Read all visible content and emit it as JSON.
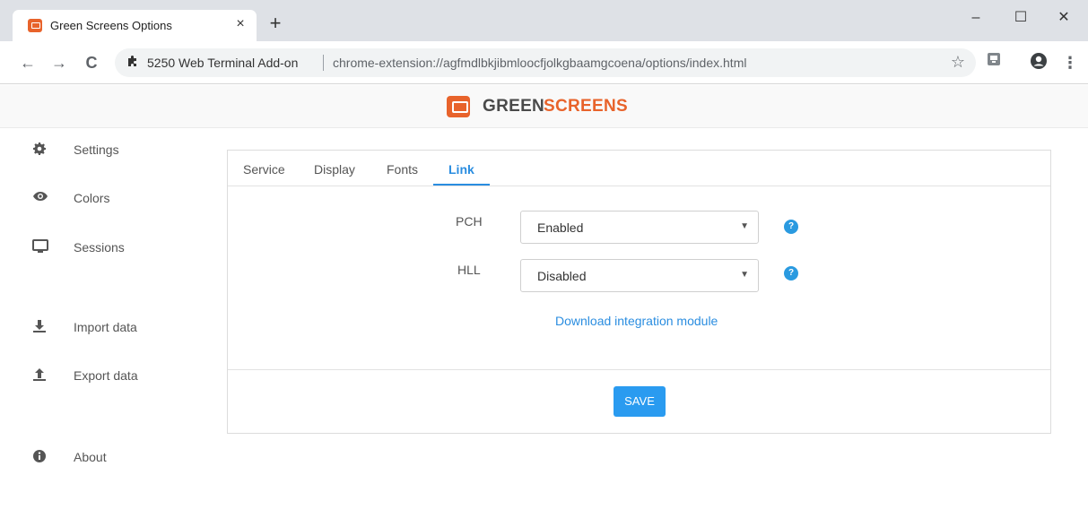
{
  "browser": {
    "tab_title": "Green Screens Options",
    "tab_close": "×",
    "new_tab": "+",
    "minimize": "–",
    "maximize": "☐",
    "close": "✕",
    "back": "←",
    "forward": "→",
    "reload": "C",
    "site_name": "5250 Web Terminal Add-on",
    "url": "chrome-extension://agfmdlbkjibmloocfjolkgbaamgcoena/options/index.html",
    "star": "☆",
    "menu": "⋮"
  },
  "header": {
    "logo_part1": "GREEN",
    "logo_part2": "SCREENS",
    "brand_color": "#e8632b"
  },
  "sidebar": {
    "items": [
      {
        "label": "Settings",
        "icon": "gear-icon"
      },
      {
        "label": "Colors",
        "icon": "eye-icon"
      },
      {
        "label": "Sessions",
        "icon": "monitor-icon"
      },
      {
        "label": "Import data",
        "icon": "download-icon"
      },
      {
        "label": "Export data",
        "icon": "upload-icon"
      },
      {
        "label": "About",
        "icon": "info-icon"
      }
    ]
  },
  "tabs": [
    {
      "label": "Service"
    },
    {
      "label": "Display"
    },
    {
      "label": "Fonts"
    },
    {
      "label": "Link",
      "active": true
    }
  ],
  "form": {
    "pch": {
      "label": "PCH",
      "value": "Enabled"
    },
    "hll": {
      "label": "HLL",
      "value": "Disabled"
    },
    "help_glyph": "?",
    "download_link": "Download integration module",
    "save_label": "SAVE"
  },
  "colors": {
    "accent": "#2a8de0",
    "button": "#2a9bf0"
  }
}
